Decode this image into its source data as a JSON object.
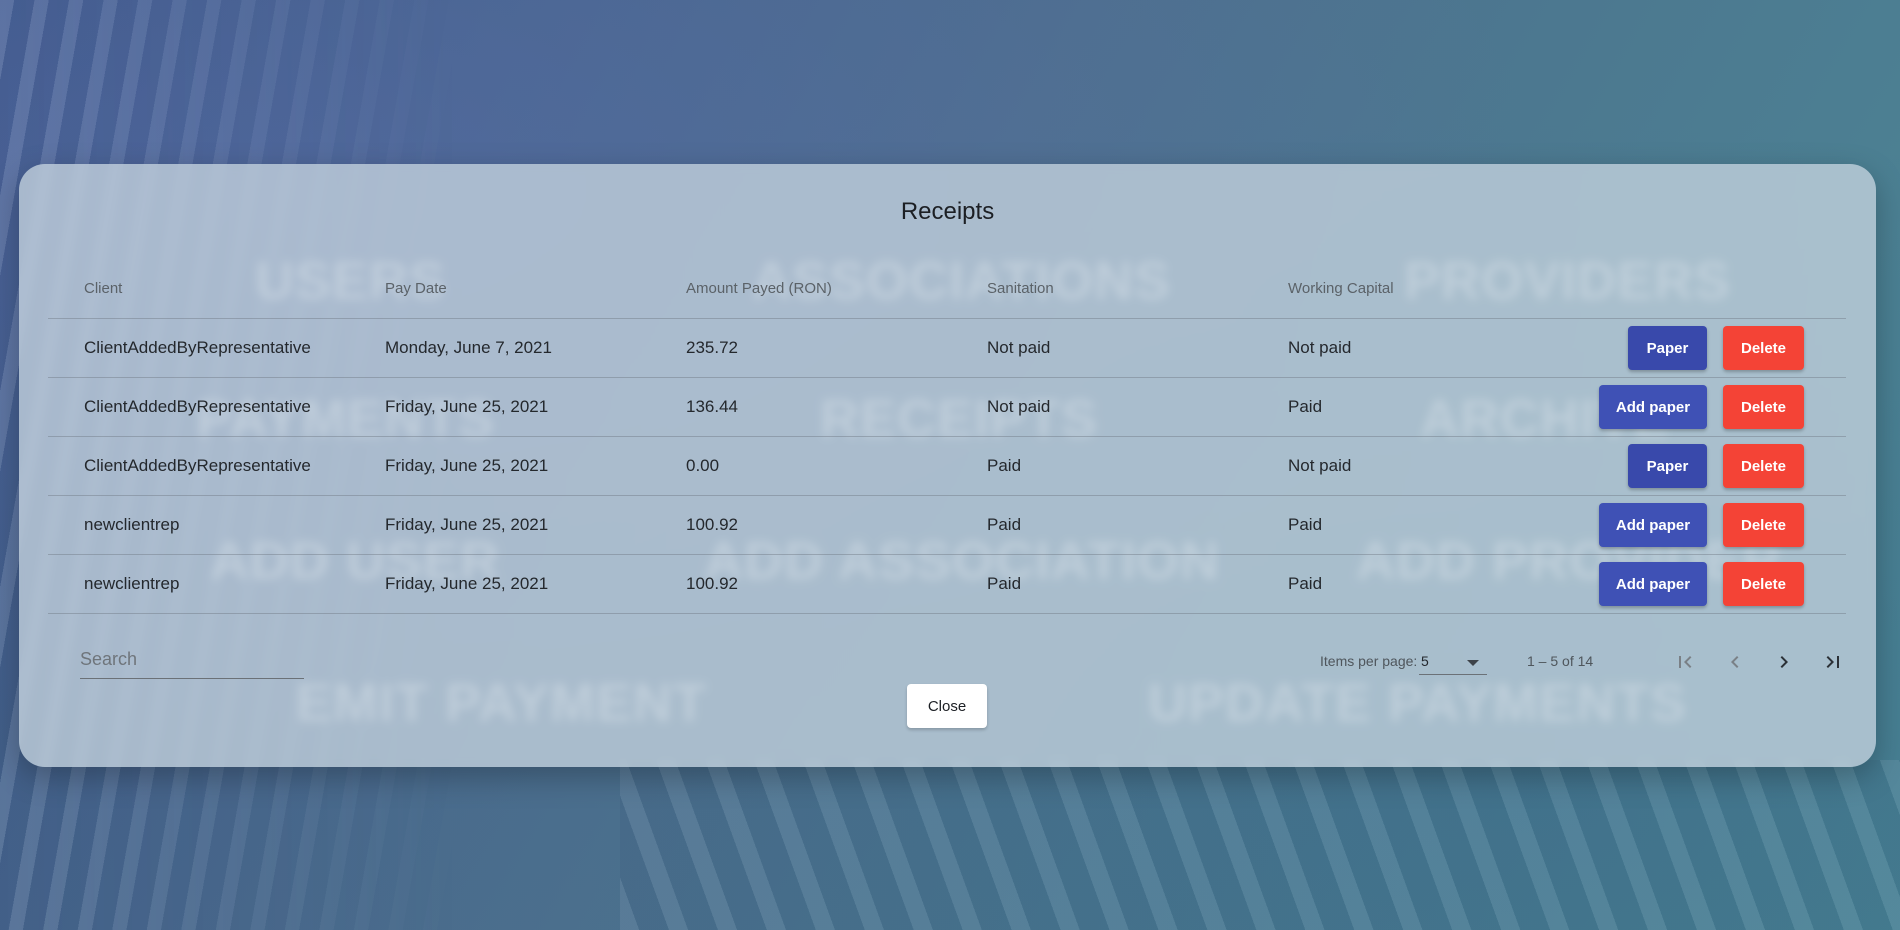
{
  "background_menu": {
    "items": [
      "USERS",
      "ASSOCIATIONS",
      "PROVIDERS",
      "PAYMENTS",
      "RECEIPTS",
      "ARCHIVE",
      "ADD USER",
      "ADD ASSOCIATION",
      "ADD PROVIDER",
      "EMIT PAYMENT",
      "UPDATE PAYMENTS"
    ]
  },
  "dialog": {
    "title": "Receipts",
    "table": {
      "headers": [
        "Client",
        "Pay Date",
        "Amount Payed (RON)",
        "Sanitation",
        "Working Capital"
      ],
      "rows": [
        {
          "client": "ClientAddedByRepresentative",
          "pay_date": "Monday, June 7, 2021",
          "amount": "235.72",
          "sanitation": "Not paid",
          "working_capital": "Not paid",
          "paper_label": "Paper",
          "delete_label": "Delete"
        },
        {
          "client": "ClientAddedByRepresentative",
          "pay_date": "Friday, June 25, 2021",
          "amount": "136.44",
          "sanitation": "Not paid",
          "working_capital": "Paid",
          "paper_label": "Add paper",
          "delete_label": "Delete"
        },
        {
          "client": "ClientAddedByRepresentative",
          "pay_date": "Friday, June 25, 2021",
          "amount": "0.00",
          "sanitation": "Paid",
          "working_capital": "Not paid",
          "paper_label": "Paper",
          "delete_label": "Delete"
        },
        {
          "client": "newclientrep",
          "pay_date": "Friday, June 25, 2021",
          "amount": "100.92",
          "sanitation": "Paid",
          "working_capital": "Paid",
          "paper_label": "Add paper",
          "delete_label": "Delete"
        },
        {
          "client": "newclientrep",
          "pay_date": "Friday, June 25, 2021",
          "amount": "100.92",
          "sanitation": "Paid",
          "working_capital": "Paid",
          "paper_label": "Add paper",
          "delete_label": "Delete"
        }
      ]
    },
    "search": {
      "placeholder": "Search",
      "value": ""
    },
    "paginator": {
      "items_per_page_label": "Items per page:",
      "items_per_page_value": "5",
      "range_label": "1 – 5 of 14",
      "icons": [
        "first-page-icon",
        "previous-page-icon",
        "next-page-icon",
        "last-page-icon"
      ]
    },
    "close_label": "Close"
  },
  "colors": {
    "paper_button": "#3949ab",
    "add_paper_button": "#3f51b5",
    "delete_button": "#f44336",
    "dialog_background": "#c4d2de"
  }
}
